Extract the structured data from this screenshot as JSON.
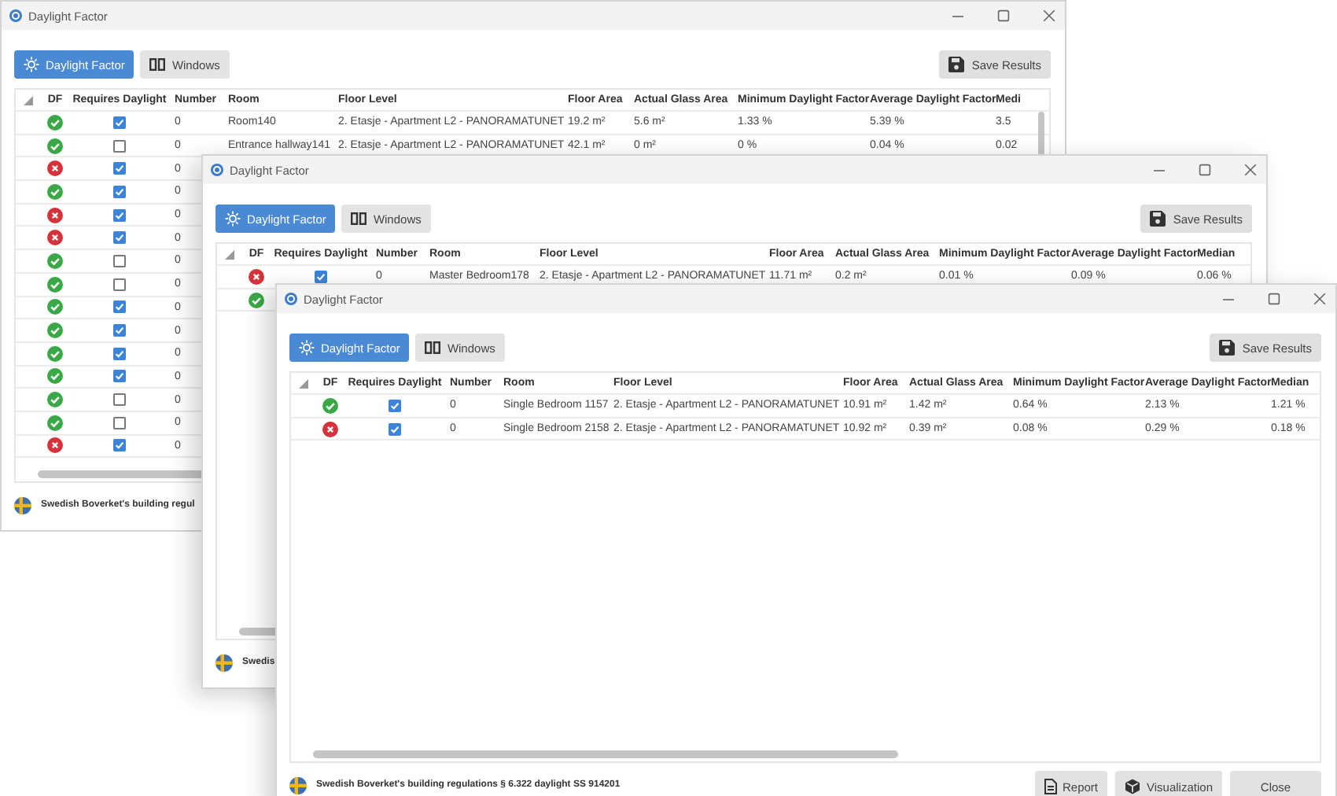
{
  "windows": [
    {
      "title": "Daylight Factor",
      "tabs": [
        {
          "label": "Daylight Factor",
          "kind": "daylight",
          "selected": true
        },
        {
          "label": "Windows",
          "kind": "windows",
          "selected": false
        }
      ],
      "save_button": "Save Results",
      "columns": [
        "DF",
        "Requires Daylight",
        "Number",
        "Room",
        "Floor Level",
        "Floor Area",
        "Actual Glass Area",
        "Minimum Daylight Factor",
        "Average Daylight Factor",
        "Medi"
      ],
      "rows": [
        {
          "df_ok": true,
          "requires_daylight": true,
          "number": "0",
          "room": "Room140",
          "floor_level": "2. Etasje - Apartment L2 - PANORAMATUNET",
          "floor_area": "19.2 m²",
          "glass_area": "5.6 m²",
          "min_df": "1.33 %",
          "avg_df": "5.39 %",
          "median_df": "3.5"
        },
        {
          "df_ok": true,
          "requires_daylight": false,
          "number": "0",
          "room": "Entrance hallway141",
          "floor_level": "2. Etasje - Apartment L2 - PANORAMATUNET",
          "floor_area": "42.1 m²",
          "glass_area": "0 m²",
          "min_df": "0 %",
          "avg_df": "0.04 %",
          "median_df": "0.02"
        },
        {
          "df_ok": false,
          "requires_daylight": true,
          "number": "0"
        },
        {
          "df_ok": true,
          "requires_daylight": true,
          "number": "0"
        },
        {
          "df_ok": false,
          "requires_daylight": true,
          "number": "0"
        },
        {
          "df_ok": false,
          "requires_daylight": true,
          "number": "0"
        },
        {
          "df_ok": true,
          "requires_daylight": false,
          "number": "0"
        },
        {
          "df_ok": true,
          "requires_daylight": false,
          "number": "0"
        },
        {
          "df_ok": true,
          "requires_daylight": true,
          "number": "0"
        },
        {
          "df_ok": true,
          "requires_daylight": true,
          "number": "0"
        },
        {
          "df_ok": true,
          "requires_daylight": true,
          "number": "0"
        },
        {
          "df_ok": true,
          "requires_daylight": true,
          "number": "0"
        },
        {
          "df_ok": true,
          "requires_daylight": false,
          "number": "0"
        },
        {
          "df_ok": true,
          "requires_daylight": false,
          "number": "0"
        },
        {
          "df_ok": false,
          "requires_daylight": true,
          "number": "0"
        }
      ],
      "footer": "Swedish Boverket's building regul"
    },
    {
      "title": "Daylight Factor",
      "tabs": [
        {
          "label": "Daylight Factor",
          "kind": "daylight",
          "selected": true
        },
        {
          "label": "Windows",
          "kind": "windows",
          "selected": false
        }
      ],
      "save_button": "Save Results",
      "columns": [
        "DF",
        "Requires Daylight",
        "Number",
        "Room",
        "Floor Level",
        "Floor Area",
        "Actual Glass Area",
        "Minimum Daylight Factor",
        "Average Daylight Factor",
        "Median"
      ],
      "rows": [
        {
          "df_ok": false,
          "requires_daylight": true,
          "number": "0",
          "room": "Master Bedroom178",
          "floor_level": "2. Etasje - Apartment L2 - PANORAMATUNET",
          "floor_area": "11.71 m²",
          "glass_area": "0.2 m²",
          "min_df": "0.01 %",
          "avg_df": "0.09 %",
          "median_df": "0.06 %"
        },
        {
          "df_ok": true
        }
      ],
      "footer": "Swedis"
    },
    {
      "title": "Daylight Factor",
      "tabs": [
        {
          "label": "Daylight Factor",
          "kind": "daylight",
          "selected": true
        },
        {
          "label": "Windows",
          "kind": "windows",
          "selected": false
        }
      ],
      "save_button": "Save Results",
      "columns": [
        "DF",
        "Requires Daylight",
        "Number",
        "Room",
        "Floor Level",
        "Floor Area",
        "Actual Glass Area",
        "Minimum Daylight Factor",
        "Average Daylight Factor",
        "Median"
      ],
      "rows": [
        {
          "df_ok": true,
          "requires_daylight": true,
          "number": "0",
          "room": "Single Bedroom 1157",
          "floor_level": "2. Etasje - Apartment L2 - PANORAMATUNET",
          "floor_area": "10.91 m²",
          "glass_area": "1.42 m²",
          "min_df": "0.64 %",
          "avg_df": "2.13 %",
          "median_df": "1.21 %"
        },
        {
          "df_ok": false,
          "requires_daylight": true,
          "number": "0",
          "room": "Single Bedroom 2158",
          "floor_level": "2. Etasje - Apartment L2 - PANORAMATUNET",
          "floor_area": "10.92 m²",
          "glass_area": "0.39 m²",
          "min_df": "0.08 %",
          "avg_df": "0.29 %",
          "median_df": "0.18 %"
        }
      ],
      "footer": "Swedish Boverket's building regulations § 6.322 daylight SS 914201",
      "footer_buttons": [
        {
          "label": "Report",
          "kind": "report"
        },
        {
          "label": "Visualization",
          "kind": "visualization"
        },
        {
          "label": "Close",
          "kind": "close"
        }
      ]
    }
  ]
}
